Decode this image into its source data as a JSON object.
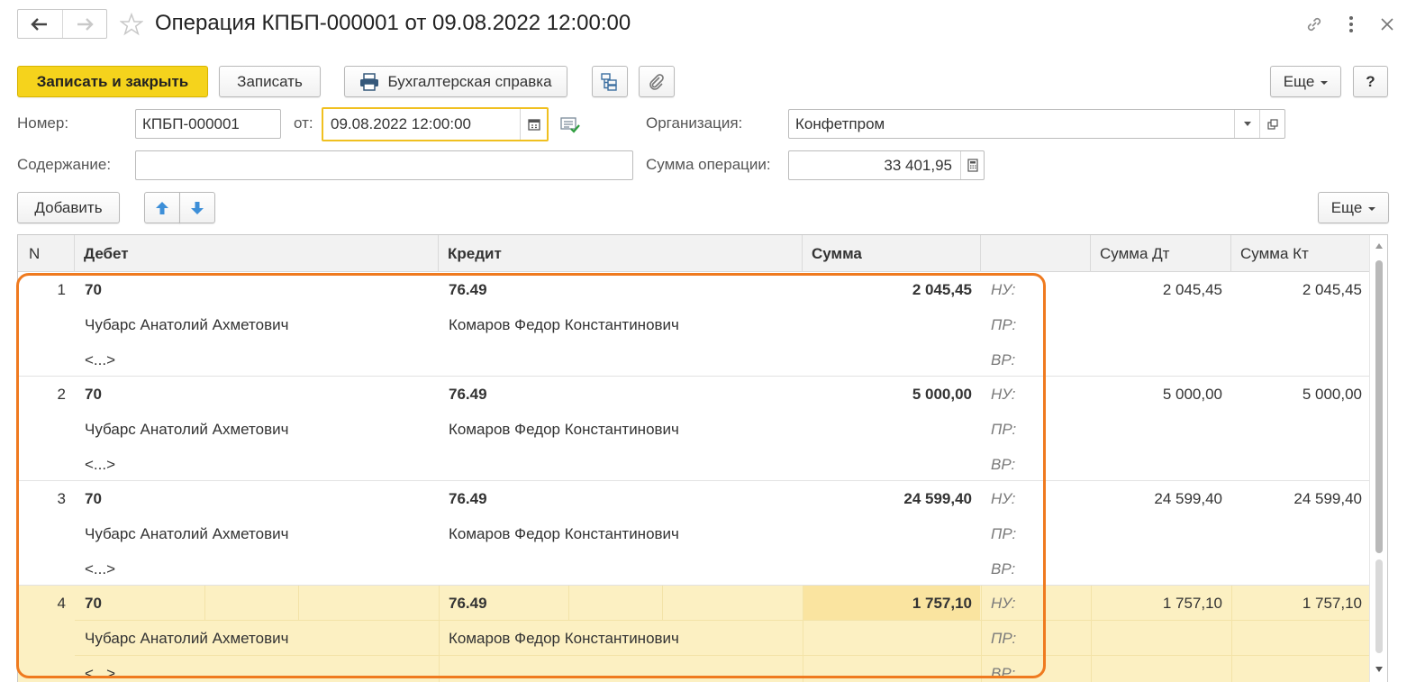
{
  "window": {
    "title": "Операция КПБП-000001 от 09.08.2022 12:00:00"
  },
  "toolbar": {
    "save_close": "Записать и закрыть",
    "save": "Записать",
    "report": "Бухгалтерская справка",
    "more": "Еще",
    "help": "?"
  },
  "form": {
    "number_label": "Номер:",
    "number_value": "КПБП-000001",
    "date_label": "от:",
    "date_value": "09.08.2022 12:00:00",
    "org_label": "Организация:",
    "org_value": "Конфетпром",
    "content_label": "Содержание:",
    "content_value": "",
    "sum_label": "Сумма операции:",
    "sum_value": "33 401,95"
  },
  "table_toolbar": {
    "add": "Добавить",
    "more": "Еще"
  },
  "table": {
    "headers": {
      "n": "N",
      "debit": "Дебет",
      "credit": "Кредит",
      "sum": "Сумма",
      "tax": "",
      "sum_dt": "Сумма Дт",
      "sum_kt": "Сумма Кт"
    },
    "rows": [
      {
        "n": "1",
        "debit": "70",
        "debit_sub": "Чубарс Анатолий Ахметович",
        "debit_sub2": "<...>",
        "credit": "76.49",
        "credit_sub": "Комаров Федор Константинович",
        "sum": "2 045,45",
        "nu": "НУ:",
        "pr": "ПР:",
        "vr": "ВР:",
        "sum_dt": "2 045,45",
        "sum_kt": "2 045,45"
      },
      {
        "n": "2",
        "debit": "70",
        "debit_sub": "Чубарс Анатолий Ахметович",
        "debit_sub2": "<...>",
        "credit": "76.49",
        "credit_sub": "Комаров Федор Константинович",
        "sum": "5 000,00",
        "nu": "НУ:",
        "pr": "ПР:",
        "vr": "ВР:",
        "sum_dt": "5 000,00",
        "sum_kt": "5 000,00"
      },
      {
        "n": "3",
        "debit": "70",
        "debit_sub": "Чубарс Анатолий Ахметович",
        "debit_sub2": "<...>",
        "credit": "76.49",
        "credit_sub": "Комаров Федор Константинович",
        "sum": "24 599,40",
        "nu": "НУ:",
        "pr": "ПР:",
        "vr": "ВР:",
        "sum_dt": "24 599,40",
        "sum_kt": "24 599,40"
      },
      {
        "n": "4",
        "debit": "70",
        "debit_sub": "Чубарс Анатолий Ахметович",
        "debit_sub2": "<...>",
        "credit": "76.49",
        "credit_sub": "Комаров Федор Константинович",
        "sum": "1 757,10",
        "nu": "НУ:",
        "pr": "ПР:",
        "vr": "ВР:",
        "sum_dt": "1 757,10",
        "sum_kt": "1 757,10"
      }
    ]
  },
  "colors": {
    "accent": "#f5d31c",
    "selection": "#fcf0c2",
    "annotation": "#ef7a1f"
  }
}
